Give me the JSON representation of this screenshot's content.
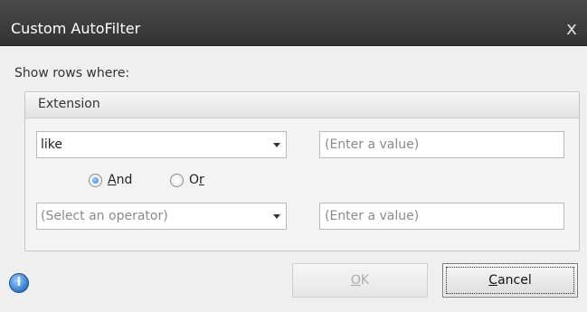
{
  "window": {
    "title": "Custom AutoFilter",
    "close_glyph": "x"
  },
  "labels": {
    "show_rows": "Show rows where:"
  },
  "group": {
    "title": "Extension"
  },
  "row1": {
    "operator_value": "like",
    "value_placeholder": "(Enter a value)"
  },
  "logic": {
    "and_prefix": "",
    "and_underlined": "A",
    "and_rest": "nd",
    "or_prefix": "O",
    "or_underlined": "r",
    "or_rest": "",
    "selected": "and"
  },
  "row2": {
    "operator_placeholder": "(Select an operator)",
    "value_placeholder": "(Enter a value)"
  },
  "buttons": {
    "ok_underlined": "O",
    "ok_rest": "K",
    "cancel_underlined": "C",
    "cancel_rest": "ancel"
  },
  "icons": {
    "info": "info-icon",
    "close": "close-icon",
    "dropdown": "chevron-down-icon"
  },
  "colors": {
    "titlebar": "#3a3a3a",
    "radio_selected": "#2f7fd3"
  }
}
